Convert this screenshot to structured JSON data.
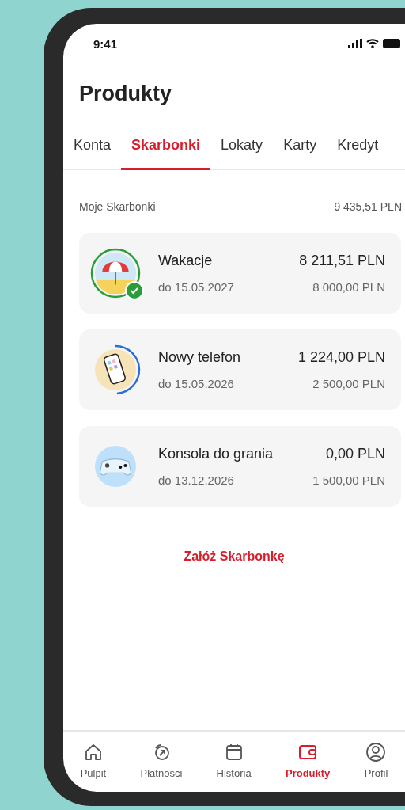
{
  "status_bar": {
    "time": "9:41"
  },
  "title": "Produkty",
  "tabs": [
    {
      "label": "Konta",
      "selected": false
    },
    {
      "label": "Skarbonki",
      "selected": true
    },
    {
      "label": "Lokaty",
      "selected": false
    },
    {
      "label": "Karty",
      "selected": false
    },
    {
      "label": "Kredyt",
      "selected": false
    }
  ],
  "summary": {
    "label": "Moje Skarbonki",
    "total": "9 435,51 PLN"
  },
  "piggy_banks": [
    {
      "kind": "beach",
      "name": "Wakacje",
      "date": "do 15.05.2027",
      "balance": "8 211,51 PLN",
      "goal": "8 000,00 PLN",
      "level": 1,
      "completed": true
    },
    {
      "kind": "phone",
      "name": "Nowy telefon",
      "date": "do 15.05.2026",
      "balance": "1 224,00 PLN",
      "goal": "2 500,00 PLN",
      "level": 0.49,
      "completed": false
    },
    {
      "kind": "gamepad",
      "name": "Konsola do grania",
      "date": "do 13.12.2026",
      "balance": "0,00 PLN",
      "goal": "1 500,00 PLN",
      "level": 0,
      "completed": false
    }
  ],
  "create_link": "Załóż Skarbonkę",
  "bottom_nav": [
    {
      "kind": "home",
      "label": "Pulpit",
      "selected": false
    },
    {
      "kind": "payments",
      "label": "Płatności",
      "selected": false
    },
    {
      "kind": "calendar",
      "label": "Historia",
      "selected": false
    },
    {
      "kind": "wallet",
      "label": "Produkty",
      "selected": true
    },
    {
      "kind": "profile",
      "label": "Profil",
      "selected": false
    }
  ]
}
